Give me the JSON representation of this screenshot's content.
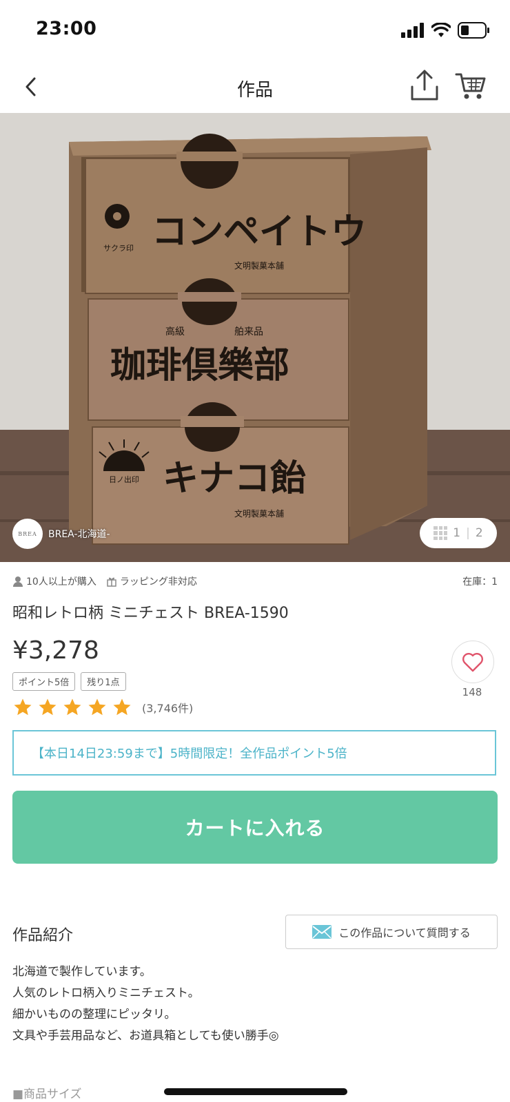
{
  "status": {
    "time": "23:00"
  },
  "nav": {
    "title": "作品"
  },
  "gallery": {
    "shop_logo_text": "BREA",
    "shop_name": "BREA-北海道-",
    "index": "1",
    "total": "2",
    "image_texts": [
      "コンペイトウ",
      "サクラ印",
      "文明製菓本舗",
      "高級",
      "舶来品",
      "珈琲倶樂部",
      "キナコ飴",
      "日ノ出印",
      "文明製菓本舗"
    ]
  },
  "meta": {
    "buyers": "10人以上が購入",
    "wrapping": "ラッピング非対応",
    "stock": "在庫：1"
  },
  "product": {
    "name": "昭和レトロ柄 ミニチェスト BREA-1590",
    "price": "¥3,278",
    "tags": [
      "ポイント5倍",
      "残り1点"
    ],
    "rating": 5,
    "review_count": "(3,746件)",
    "favorites": "148"
  },
  "promo": {
    "text": "【本日14日23:59まで】5時間限定！全作品ポイント5倍"
  },
  "cart_button": {
    "label": "カートに入れる"
  },
  "intro": {
    "title": "作品紹介",
    "ask_label": "この作品について質問する",
    "lines": [
      "北海道で製作しています。",
      "人気のレトロ柄入りミニチェスト。",
      "細かいものの整理にピッタリ。",
      "文具や手芸用品など、お道具箱としても使い勝手◎"
    ]
  },
  "size_heading": "■商品サイズ",
  "colors": {
    "cart": "#63c8a3",
    "promo": "#4bb3c8",
    "star": "#f5a623",
    "heart": "#e0546b"
  }
}
